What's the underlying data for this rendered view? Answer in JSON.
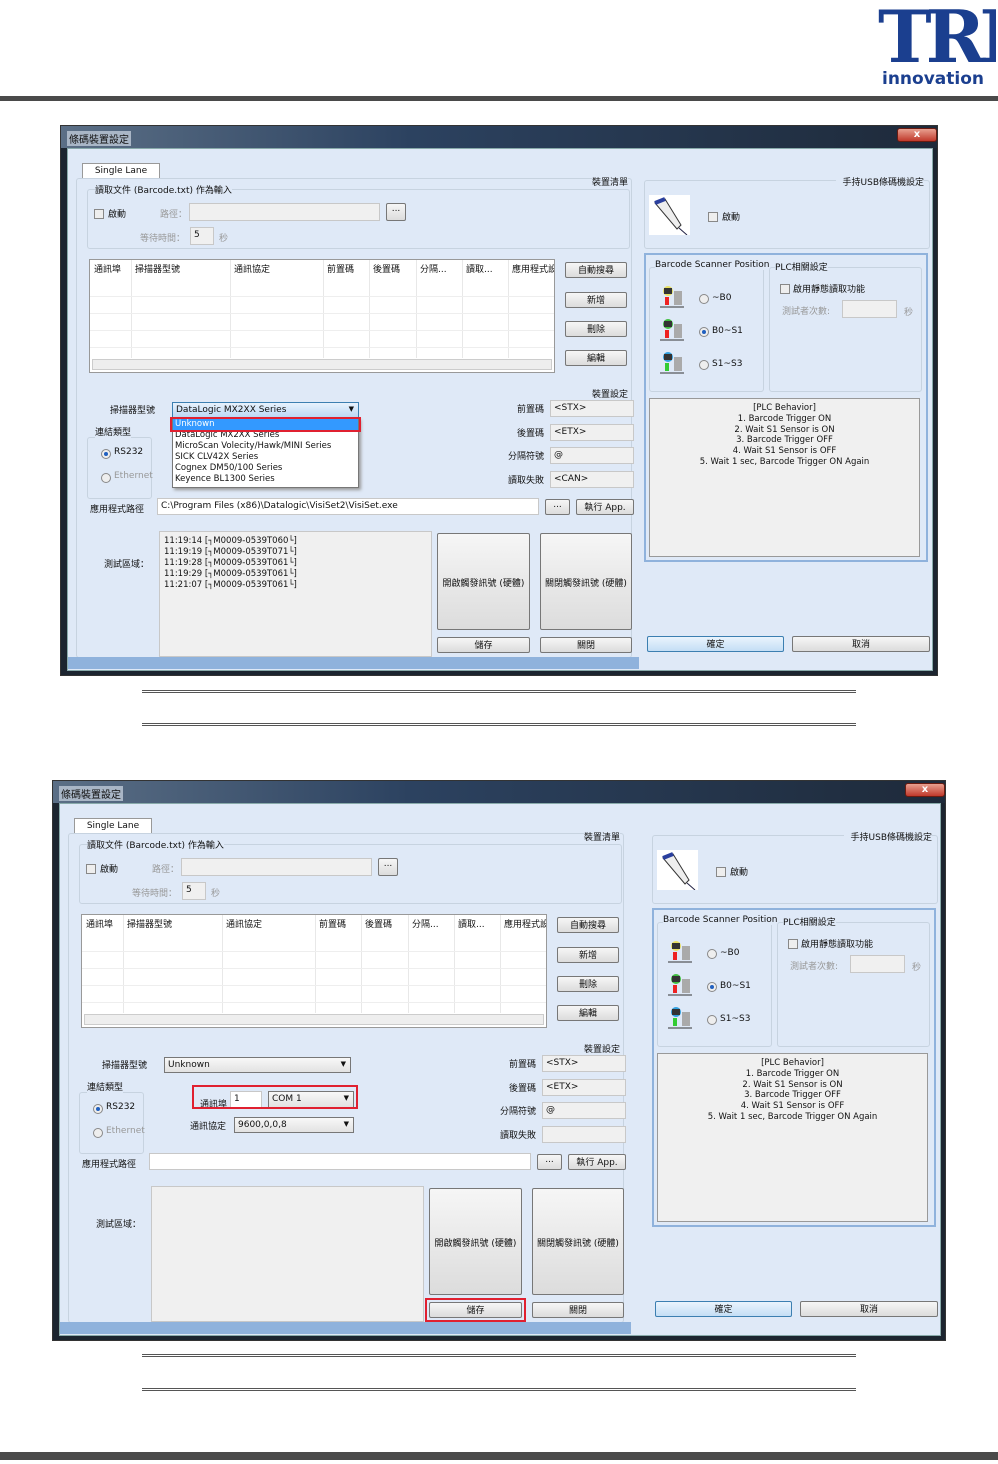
{
  "logo": {
    "text": "TRI",
    "subtext": "innovation",
    "color": "#1b3f8f"
  },
  "dialogs": [
    {
      "title": "條碼裝置設定",
      "close": "x",
      "tab": "Single Lane",
      "device_list_label": "裝置清單",
      "file_group": {
        "legend": "讀取文件 (Barcode.txt) 作為輸入",
        "enable": "啟動",
        "path_label": "路徑：",
        "path_value": "",
        "browse": "...",
        "wait_label": "等待時間：",
        "wait_value": "5",
        "wait_unit": "秒"
      },
      "table_headers": [
        "通訊埠",
        "掃描器型號",
        "通訊協定",
        "前置碼",
        "後置碼",
        "分隔...",
        "讀取...",
        "應用程式設"
      ],
      "list_buttons": [
        "自動搜尋",
        "新增",
        "刪除",
        "編輯"
      ],
      "device_settings_label": "裝置設定",
      "scanner_model_label": "掃描器型號",
      "scanner_model_value": "DataLogic MX2XX Series",
      "dropdown_items": [
        "Unknown",
        "DataLogic MX2XX Series",
        "MicroScan Volecity/Hawk/MINI Series",
        "SICK CLV42X Series",
        "Cognex DM50/100 Series",
        "Keyence BL1300 Series"
      ],
      "conn_type_label": "連結類型",
      "rs232": "RS232",
      "ethernet": "Ethernet",
      "right_fields": [
        {
          "label": "前置碼",
          "value": "<STX>"
        },
        {
          "label": "後置碼",
          "value": "<ETX>"
        },
        {
          "label": "分隔符號",
          "value": "@"
        },
        {
          "label": "讀取失敗",
          "value": "<CAN>"
        }
      ],
      "app_path_label": "應用程式路徑",
      "app_path_value": "C:\\Program Files (x86)\\Datalogic\\VisiSet2\\VisiSet.exe",
      "app_browse": "...",
      "run_app": "執行 App.",
      "test_area_label": "測試區域：",
      "test_log": [
        "11:19:14 [┐M0009-0539T060└]",
        "11:19:19 [┐M0009-0539T071└]",
        "11:19:28 [┐M0009-0539T061└]",
        "11:19:29 [┐M0009-0539T061└]",
        "11:21:07 [┐M0009-0539T061└]"
      ],
      "open_trigger": "開啟觸發訊號 (硬體)",
      "close_trigger": "關閉觸發訊號 (硬體)",
      "save": "儲存",
      "close_btn": "關閉",
      "usb_group_label": "手持USB條碼機設定",
      "usb_enable": "啟動",
      "bsp_label": "Barcode Scanner Position",
      "positions": [
        "~B0",
        "B0~S1",
        "S1~S3"
      ],
      "plc_label": "PLC相關設定",
      "static_read": "啟用靜態讀取功能",
      "test_count_label": "測試者次數:",
      "test_count_unit": "秒",
      "plc_behavior": [
        "[PLC Behavior]",
        "1. Barcode Trigger ON",
        "2. Wait S1 Sensor is ON",
        "3. Barcode Trigger OFF",
        "4. Wait S1 Sensor is OFF",
        "5. Wait 1 sec, Barcode Trigger ON Again"
      ],
      "ok": "確定",
      "cancel": "取消"
    },
    {
      "title": "條碼裝置設定",
      "close": "x",
      "tab": "Single Lane",
      "device_list_label": "裝置清單",
      "file_group": {
        "legend": "讀取文件 (Barcode.txt) 作為輸入",
        "enable": "啟動",
        "path_label": "路徑：",
        "path_value": "",
        "browse": "...",
        "wait_label": "等待時間：",
        "wait_value": "5",
        "wait_unit": "秒"
      },
      "table_headers": [
        "通訊埠",
        "掃描器型號",
        "通訊協定",
        "前置碼",
        "後置碼",
        "分隔...",
        "讀取...",
        "應用程式設"
      ],
      "list_buttons": [
        "自動搜尋",
        "新增",
        "刪除",
        "編輯"
      ],
      "device_settings_label": "裝置設定",
      "scanner_model_label": "掃描器型號",
      "scanner_model_value": "Unknown",
      "conn_type_label": "連結類型",
      "rs232": "RS232",
      "ethernet": "Ethernet",
      "com_port_label": "通訊埠",
      "com_port_value": "1",
      "com_port_select": "COM 1",
      "protocol_label": "通訊協定",
      "protocol_value": "9600,0,0,8",
      "right_fields": [
        {
          "label": "前置碼",
          "value": "<STX>"
        },
        {
          "label": "後置碼",
          "value": "<ETX>"
        },
        {
          "label": "分隔符號",
          "value": "@"
        },
        {
          "label": "讀取失敗",
          "value": ""
        }
      ],
      "app_path_label": "應用程式路徑",
      "app_path_value": "",
      "app_browse": "...",
      "run_app": "執行 App.",
      "test_area_label": "測試區域：",
      "test_log": [],
      "open_trigger": "開啟觸發訊號 (硬體)",
      "close_trigger": "關閉觸發訊號 (硬體)",
      "save": "儲存",
      "close_btn": "關閉",
      "usb_group_label": "手持USB條碼機設定",
      "usb_enable": "啟動",
      "bsp_label": "Barcode Scanner Position",
      "positions": [
        "~B0",
        "B0~S1",
        "S1~S3"
      ],
      "plc_label": "PLC相關設定",
      "static_read": "啟用靜態讀取功能",
      "test_count_label": "測試者次數:",
      "test_count_unit": "秒",
      "plc_behavior": [
        "[PLC Behavior]",
        "1. Barcode Trigger ON",
        "2. Wait S1 Sensor is ON",
        "3. Barcode Trigger OFF",
        "4. Wait S1 Sensor is OFF",
        "5. Wait 1 sec, Barcode Trigger ON Again"
      ],
      "ok": "確定",
      "cancel": "取消"
    }
  ]
}
